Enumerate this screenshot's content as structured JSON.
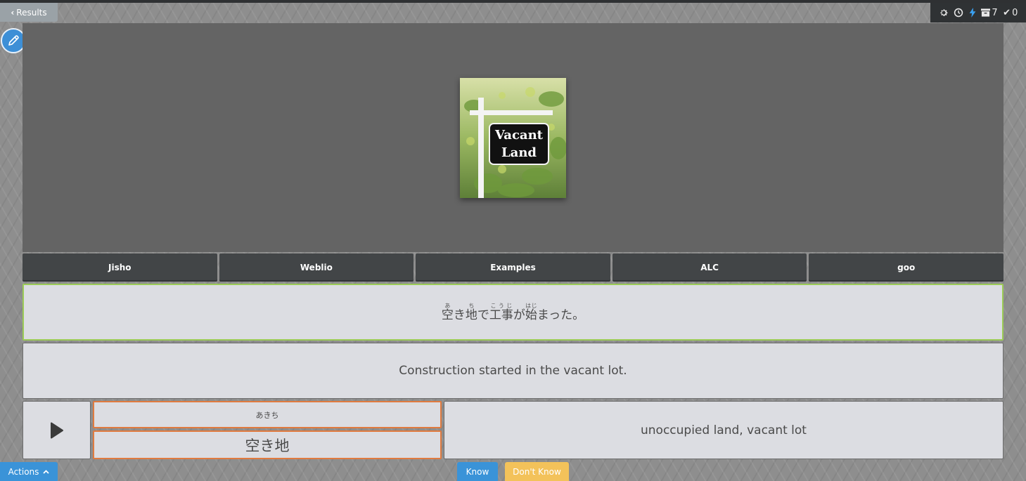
{
  "nav": {
    "results_label": "Results"
  },
  "status": {
    "review_count": "7",
    "correct_count": "0"
  },
  "card": {
    "image_text": "Vacant Land",
    "sentence_jp": {
      "segments": [
        {
          "text": "空",
          "ruby": "あ"
        },
        {
          "text": "き",
          "ruby": ""
        },
        {
          "text": "地",
          "ruby": "ち"
        },
        {
          "text": "で",
          "ruby": ""
        },
        {
          "text": "工事",
          "ruby": "こうじ"
        },
        {
          "text": "が",
          "ruby": ""
        },
        {
          "text": "始",
          "ruby": "はじ"
        },
        {
          "text": "まった。",
          "ruby": ""
        }
      ]
    },
    "sentence_en": "Construction started in the vacant lot.",
    "reading": "あきち",
    "word": "空き地",
    "meaning": "unoccupied land, vacant lot"
  },
  "dictionaries": [
    {
      "label": "Jisho"
    },
    {
      "label": "Weblio"
    },
    {
      "label": "Examples"
    },
    {
      "label": "ALC"
    },
    {
      "label": "goo"
    }
  ],
  "footer": {
    "actions_label": "Actions",
    "know_label": "Know",
    "dont_know_label": "Don't Know"
  },
  "colors": {
    "accent_blue": "#3a93d8",
    "dont_know_yellow": "#f3c25a",
    "sentence_border_green": "#9ccb57",
    "word_border_orange": "#e07a3f"
  }
}
